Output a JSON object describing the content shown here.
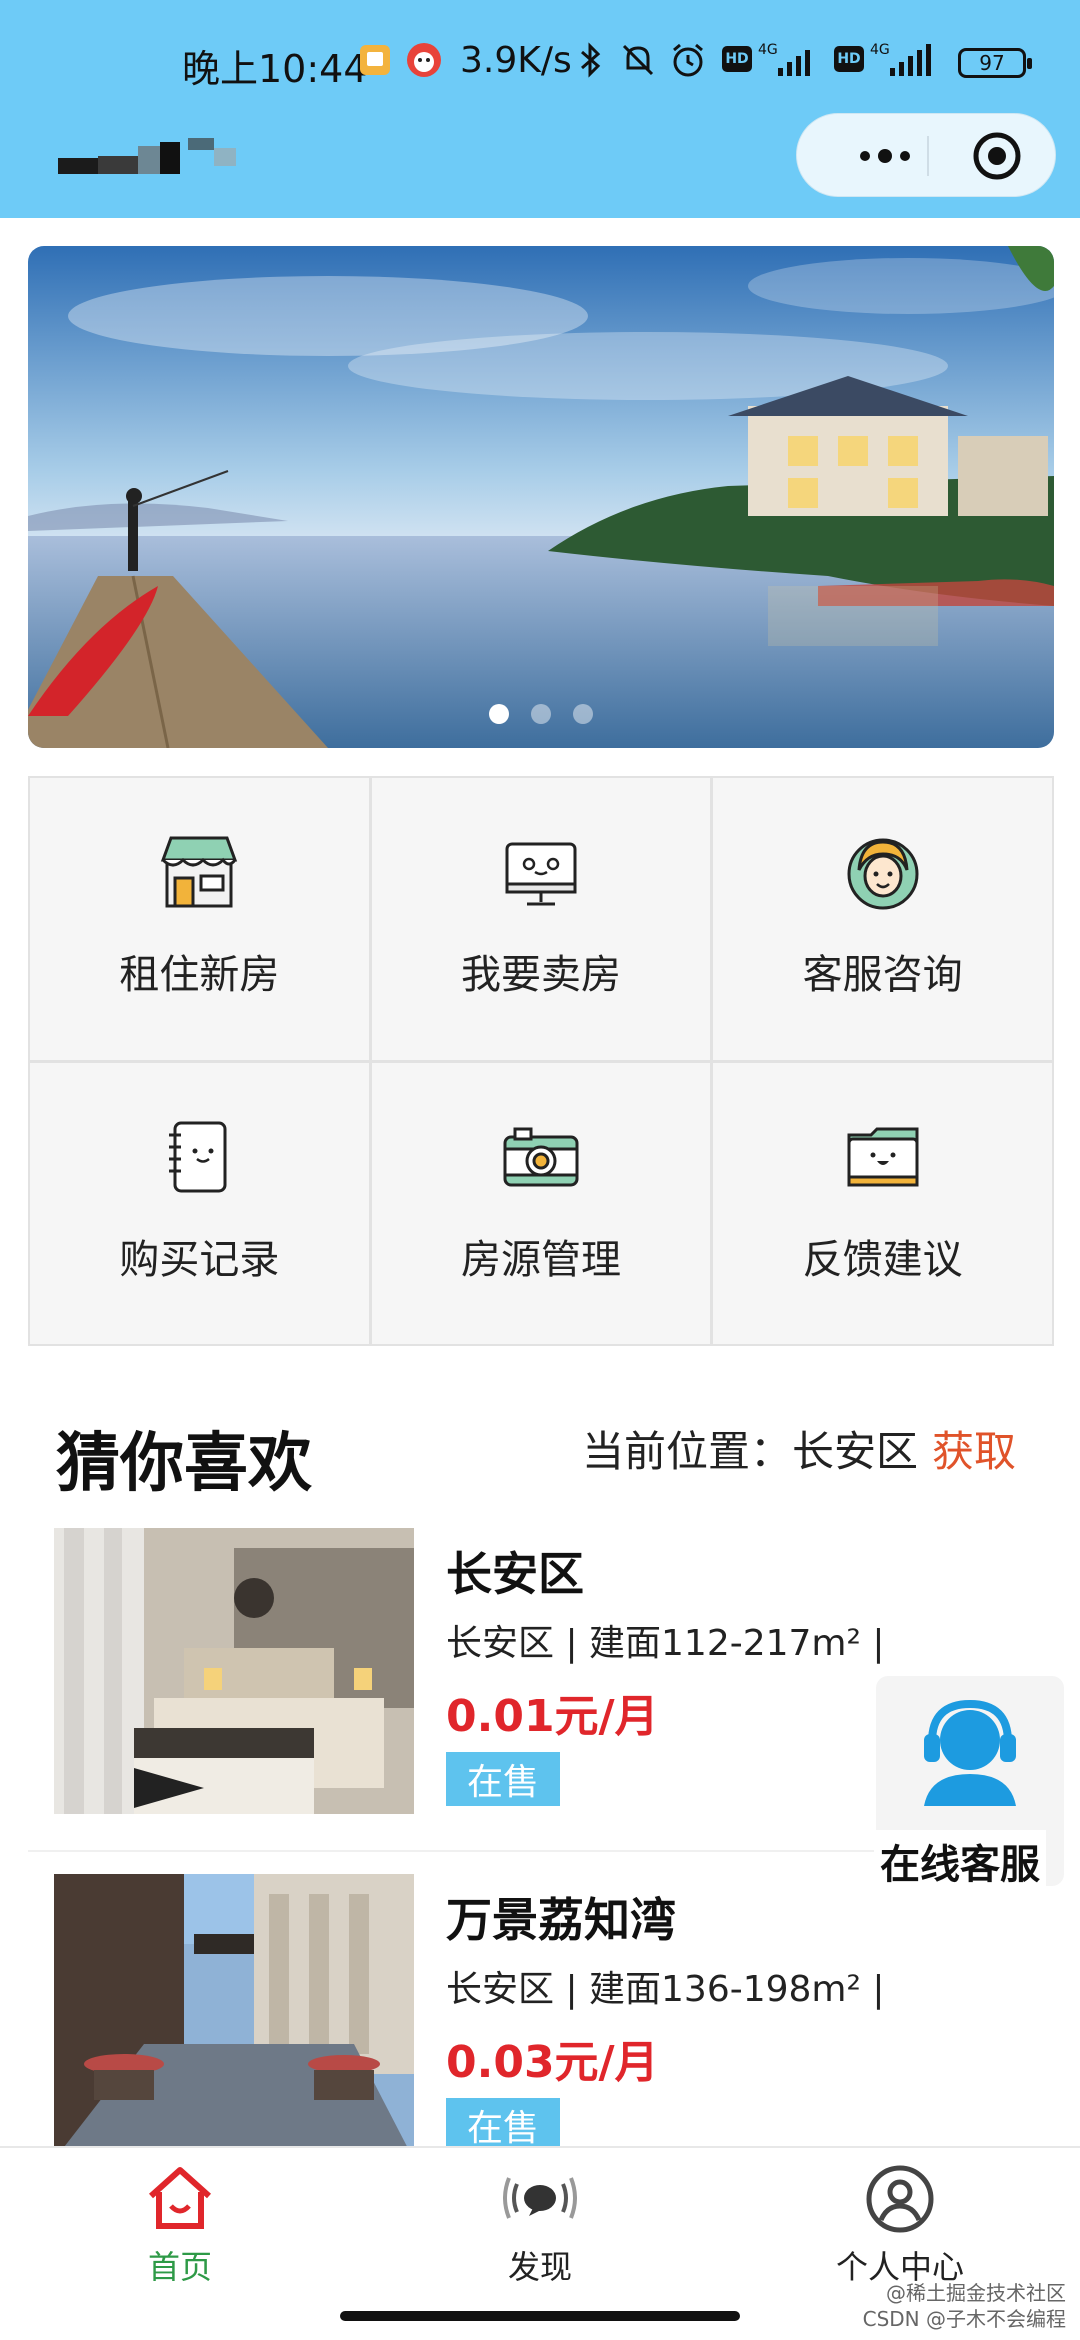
{
  "status_bar": {
    "time": "晚上10:44",
    "speed": "3.9K/s",
    "network_1": "4G",
    "network_2": "4G",
    "hd": "HD",
    "battery": "97"
  },
  "header": {
    "more_icon": "more-dots-icon",
    "close_icon": "target-close-icon"
  },
  "banner": {
    "slides": 3,
    "active_index": 0
  },
  "menu": {
    "items": [
      {
        "label": "租住新房",
        "icon": "shop-icon"
      },
      {
        "label": "我要卖房",
        "icon": "monitor-icon"
      },
      {
        "label": "客服咨询",
        "icon": "agent-face-icon"
      },
      {
        "label": "购买记录",
        "icon": "notebook-icon"
      },
      {
        "label": "房源管理",
        "icon": "camera-icon"
      },
      {
        "label": "反馈建议",
        "icon": "folder-icon"
      }
    ]
  },
  "recommend": {
    "title": "猜你喜欢",
    "location_label": "当前位置：长安区",
    "get_label": "获取",
    "listings": [
      {
        "name": "长安区",
        "meta": "长安区 | 建面112-217m² |",
        "price": "0.01元/月",
        "tag": "在售"
      },
      {
        "name": "万景荔知湾",
        "meta": "长安区 | 建面136-198m² |",
        "price": "0.03元/月",
        "tag": "在售"
      }
    ]
  },
  "float_service": {
    "label": "在线客服",
    "icon": "headset-user-icon"
  },
  "tabbar": {
    "tabs": [
      {
        "label": "首页",
        "icon": "home-icon",
        "active": true
      },
      {
        "label": "发现",
        "icon": "discover-icon",
        "active": false
      },
      {
        "label": "个人中心",
        "icon": "user-icon",
        "active": false
      }
    ]
  },
  "watermark": {
    "line1": "@稀土掘金技术社区",
    "line2": "CSDN @子木不会编程"
  },
  "colors": {
    "header_bg": "#6ecbf7",
    "accent_red": "#e0262b",
    "tag_blue": "#5ec3ee",
    "tab_active": "#2e9a47",
    "get_orange": "#e0532a"
  }
}
